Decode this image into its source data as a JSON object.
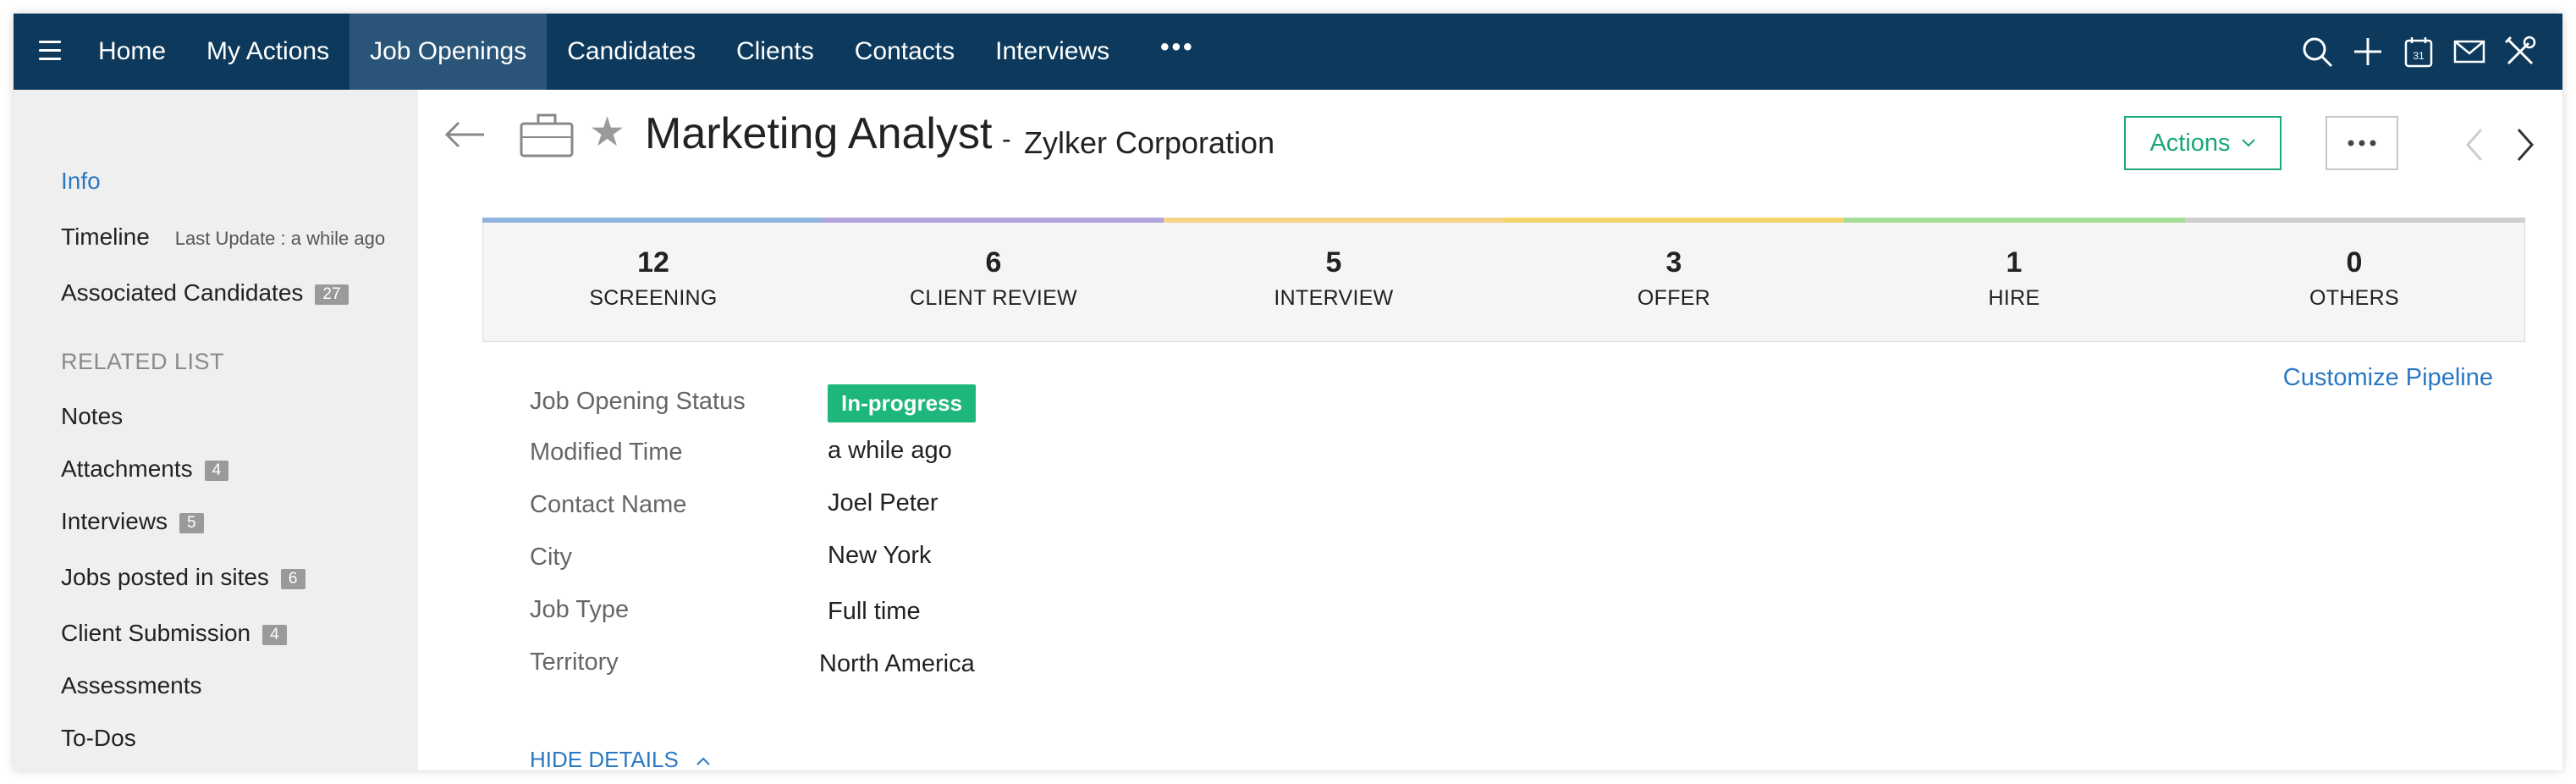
{
  "nav": {
    "items": [
      {
        "label": "Home",
        "active": false
      },
      {
        "label": "My Actions",
        "active": false
      },
      {
        "label": "Job Openings",
        "active": true
      },
      {
        "label": "Candidates",
        "active": false
      },
      {
        "label": "Clients",
        "active": false
      },
      {
        "label": "Contacts",
        "active": false
      },
      {
        "label": "Interviews",
        "active": false
      }
    ],
    "more_label": "•••",
    "icons": [
      "search-icon",
      "plus-icon",
      "calendar-icon",
      "mail-icon",
      "tools-icon"
    ],
    "calendar_day": "31"
  },
  "sidebar": {
    "info": "Info",
    "timeline": "Timeline",
    "last_update": "Last Update : a while ago",
    "associated_candidates": "Associated Candidates",
    "associated_candidates_count": "27",
    "related_heading": "RELATED LIST",
    "related": [
      {
        "label": "Notes",
        "count": ""
      },
      {
        "label": "Attachments",
        "count": "4"
      },
      {
        "label": "Interviews",
        "count": "5"
      },
      {
        "label": "Jobs posted in sites",
        "count": "6"
      },
      {
        "label": "Client Submission",
        "count": "4"
      },
      {
        "label": "Assessments",
        "count": ""
      },
      {
        "label": "To-Dos",
        "count": ""
      }
    ]
  },
  "header": {
    "title": "Marketing Analyst",
    "separator": "-",
    "client": "Zylker Corporation",
    "actions_label": "Actions"
  },
  "pipeline": {
    "stages": [
      {
        "count": "12",
        "label": "SCREENING"
      },
      {
        "count": "6",
        "label": "CLIENT REVIEW"
      },
      {
        "count": "5",
        "label": "INTERVIEW"
      },
      {
        "count": "3",
        "label": "OFFER"
      },
      {
        "count": "1",
        "label": "HIRE"
      },
      {
        "count": "0",
        "label": "OTHERS"
      }
    ],
    "colors": [
      "#8fb4e0",
      "#b3a3dc",
      "#f6d389",
      "#f0d46a",
      "#a6dd96",
      "#cfcfcf"
    ],
    "customize_label": "Customize Pipeline"
  },
  "details": {
    "status_label": "Job Opening Status",
    "status_value": "In-progress",
    "status_color": "#1db67b",
    "fields": [
      {
        "label": "Modified Time",
        "value": "a while ago"
      },
      {
        "label": "Contact Name",
        "value": "Joel Peter"
      },
      {
        "label": "City",
        "value": "New York"
      },
      {
        "label": "Job Type",
        "value": "Full time"
      },
      {
        "label": "Territory",
        "value": "North America"
      }
    ],
    "hide_label": "HIDE DETAILS"
  }
}
